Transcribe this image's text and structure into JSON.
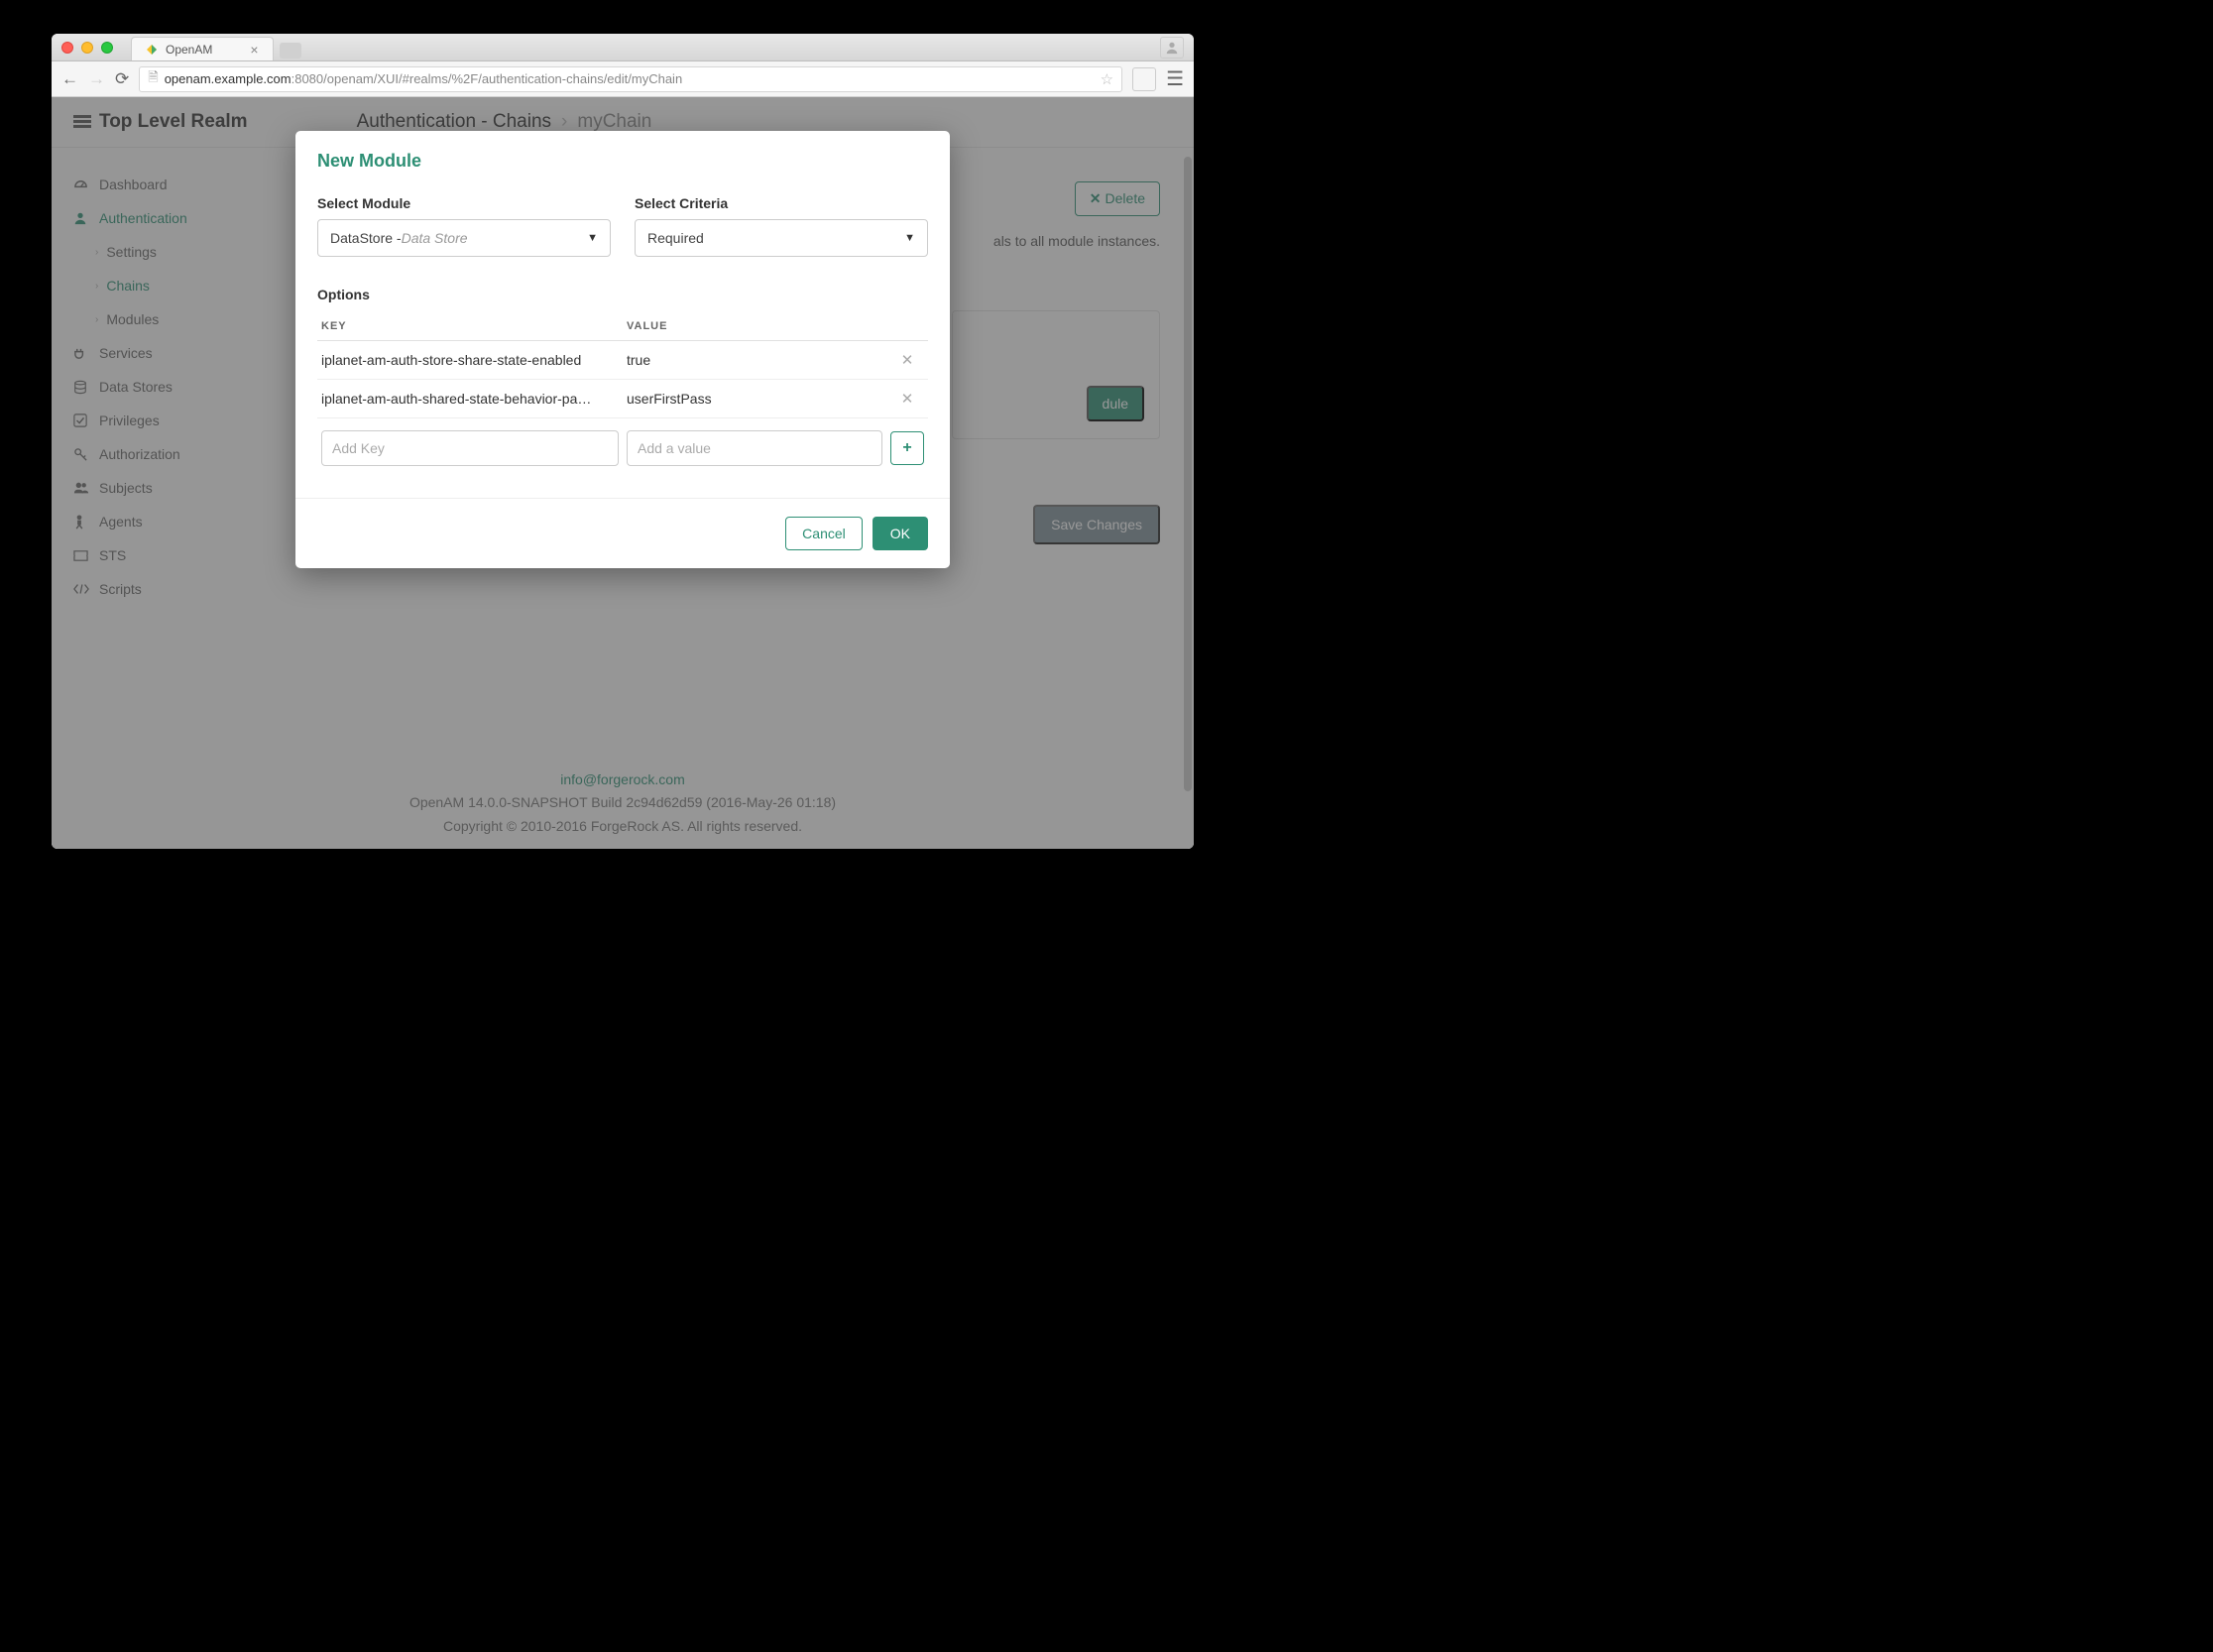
{
  "browser": {
    "tab_title": "OpenAM",
    "url_host": "openam.example.com",
    "url_port": ":8080",
    "url_path": "/openam/XUI/#realms/%2F/authentication-chains/edit/myChain"
  },
  "header": {
    "realm_label": "Top Level Realm",
    "breadcrumb1": "Authentication - Chains",
    "breadcrumb2": "myChain"
  },
  "sidebar": {
    "dashboard": "Dashboard",
    "authentication": "Authentication",
    "settings": "Settings",
    "chains": "Chains",
    "modules": "Modules",
    "services": "Services",
    "data_stores": "Data Stores",
    "privileges": "Privileges",
    "authorization": "Authorization",
    "subjects": "Subjects",
    "agents": "Agents",
    "sts": "STS",
    "scripts": "Scripts"
  },
  "main": {
    "delete": "Delete",
    "hint_fragment": "als to all module instances.",
    "add_module_fragment": "dule",
    "save_changes": "Save Changes"
  },
  "modal": {
    "title": "New Module",
    "select_module_label": "Select Module",
    "select_module_value": "DataStore - ",
    "select_module_suffix": "Data Store",
    "select_criteria_label": "Select Criteria",
    "select_criteria_value": "Required",
    "options_label": "Options",
    "th_key": "KEY",
    "th_value": "VALUE",
    "rows": [
      {
        "key": "iplanet-am-auth-store-share-state-enabled",
        "value": "true"
      },
      {
        "key": "iplanet-am-auth-shared-state-behavior-pattern",
        "value": "userFirstPass"
      }
    ],
    "add_key_placeholder": "Add Key",
    "add_value_placeholder": "Add a value",
    "cancel": "Cancel",
    "ok": "OK"
  },
  "footer": {
    "email": "info@forgerock.com",
    "build": "OpenAM 14.0.0-SNAPSHOT Build 2c94d62d59 (2016-May-26 01:18)",
    "copyright": "Copyright © 2010-2016 ForgeRock AS. All rights reserved."
  }
}
